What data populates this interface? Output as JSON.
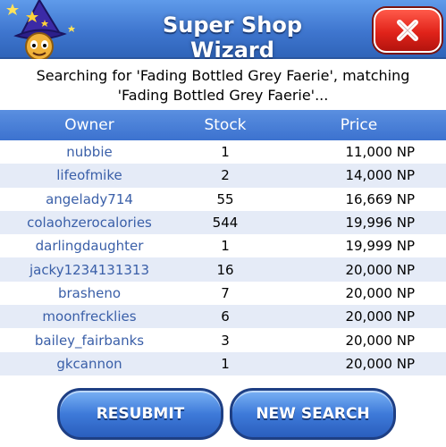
{
  "header": {
    "title": "Super Shop Wizard"
  },
  "search": {
    "message": "Searching for 'Fading Bottled Grey Faerie', matching 'Fading Bottled Grey Faerie'..."
  },
  "table": {
    "columns": [
      "Owner",
      "Stock",
      "Price"
    ],
    "rows": [
      {
        "owner": "nubbie",
        "stock": "1",
        "price": "11,000 NP"
      },
      {
        "owner": "lifeofmike",
        "stock": "2",
        "price": "14,000 NP"
      },
      {
        "owner": "angelady714",
        "stock": "55",
        "price": "16,669 NP"
      },
      {
        "owner": "colaohzerocalories",
        "stock": "544",
        "price": "19,996 NP"
      },
      {
        "owner": "darlingdaughter",
        "stock": "1",
        "price": "19,999 NP"
      },
      {
        "owner": "jacky1234131313",
        "stock": "16",
        "price": "20,000 NP"
      },
      {
        "owner": "brasheno",
        "stock": "7",
        "price": "20,000 NP"
      },
      {
        "owner": "moonfrecklies",
        "stock": "6",
        "price": "20,000 NP"
      },
      {
        "owner": "bailey_fairbanks",
        "stock": "3",
        "price": "20,000 NP"
      },
      {
        "owner": "gkcannon",
        "stock": "1",
        "price": "20,000 NP"
      }
    ]
  },
  "buttons": {
    "resubmit": "RESUBMIT",
    "new_search": "NEW SEARCH"
  },
  "icons": {
    "wizard": "wizard-avatar-icon",
    "close": "close-icon"
  },
  "colors": {
    "header": "#3f76cf",
    "close": "#e1231a",
    "link": "#3a5fa8"
  }
}
